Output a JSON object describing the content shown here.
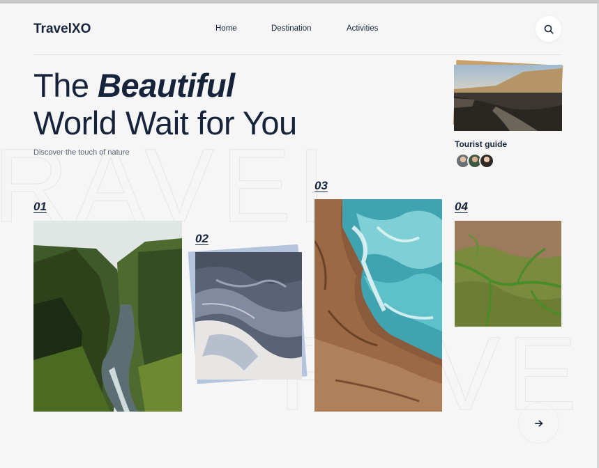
{
  "brand": {
    "name": "TravelXO"
  },
  "nav": {
    "items": [
      "Home",
      "Destination",
      "Activities"
    ]
  },
  "search": {
    "icon": "search-icon"
  },
  "hero": {
    "title_prefix": "The ",
    "title_emphasis": "Beautiful",
    "title_line2": "World Wait for You",
    "subtitle": "Discover the touch of nature"
  },
  "guide": {
    "label": "Tourist guide",
    "avatar_count": 3
  },
  "destinations": [
    {
      "number": "01",
      "image": "green-canyon-river"
    },
    {
      "number": "02",
      "image": "aerial-glacier-river"
    },
    {
      "number": "03",
      "image": "aerial-ocean-rocky-coast"
    },
    {
      "number": "04",
      "image": "aerial-green-meadow"
    }
  ],
  "next_button": {
    "icon": "arrow-right-icon"
  },
  "colors": {
    "text": "#17233a",
    "background": "#f6f6f6",
    "divider": "#e2e2e2"
  }
}
